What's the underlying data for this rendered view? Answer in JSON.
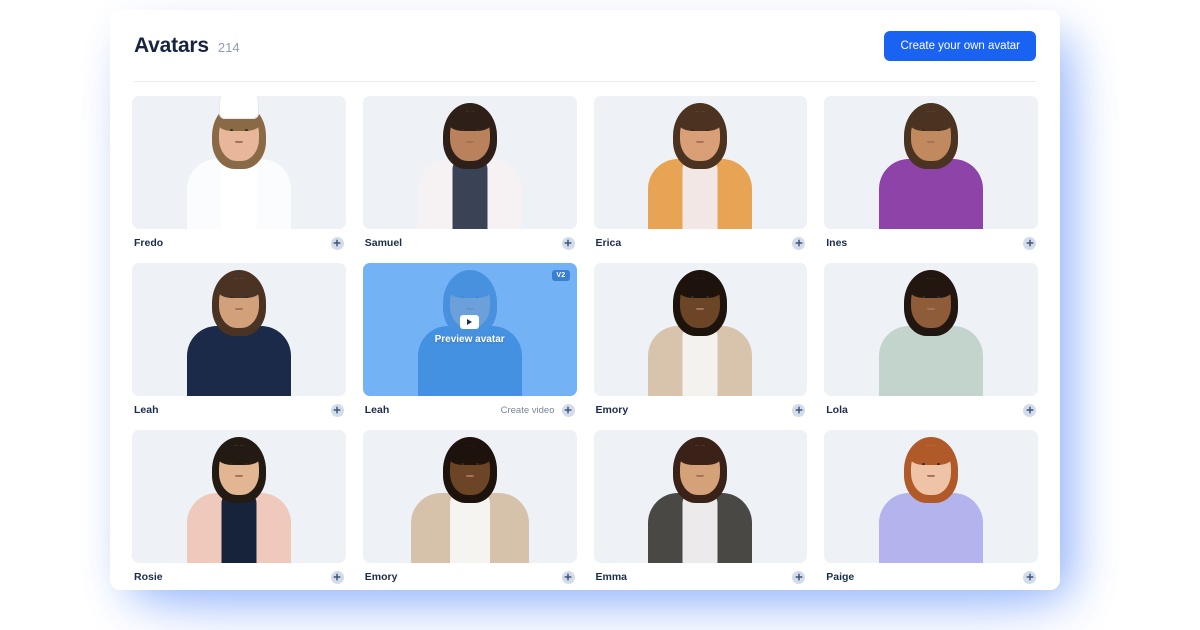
{
  "header": {
    "title": "Avatars",
    "count": "214",
    "create_button_label": "Create your own avatar"
  },
  "grid": {
    "avatars": [
      {
        "name": "Fredo",
        "description": "Male chef wearing a tall white chef's hat and white double-breasted chef jacket",
        "skin": "#e8b79a",
        "hair": "#8a6a46",
        "clothing": "#fbfcfd",
        "accent": "#ffffff",
        "state": "default"
      },
      {
        "name": "Samuel",
        "description": "Man with short curly dark hair and beard wearing a white lab coat over a dark navy shirt",
        "skin": "#b9825d",
        "hair": "#2e2018",
        "clothing": "#f6f2f4",
        "accent": "#3a4355",
        "state": "default"
      },
      {
        "name": "Erica",
        "description": "Woman with long curly brown hair wearing an orange cardigan over a white v-neck top",
        "skin": "#d9a078",
        "hair": "#4c3220",
        "clothing": "#e8a455",
        "accent": "#f2e7e4",
        "state": "default"
      },
      {
        "name": "Ines",
        "description": "Woman with a large afro wearing a purple sleeveless top",
        "skin": "#c08a5e",
        "hair": "#4a3320",
        "clothing": "#8d43a8",
        "accent": "#8d43a8",
        "state": "default"
      },
      {
        "name": "Leah",
        "description": "Woman with shoulder-length curly hair wearing a navy blue blazer",
        "skin": "#d2a17c",
        "hair": "#4b3323",
        "clothing": "#1c2a4a",
        "accent": "#1c2a4a",
        "state": "default"
      },
      {
        "name": "Leah",
        "description": "Woman with curly hair in a blue jacket, shown with blue preview overlay",
        "skin": "#d2a17c",
        "hair": "#2d5d92",
        "clothing": "#1f5e9c",
        "accent": "#1f5e9c",
        "state": "preview",
        "version_badge": "V2",
        "preview_label": "Preview avatar",
        "create_video_label": "Create video"
      },
      {
        "name": "Emory",
        "description": "Man with short hair and beard wearing a beige shirt over a white t-shirt",
        "skin": "#6b4526",
        "hair": "#1d130c",
        "clothing": "#d8c4ad",
        "accent": "#f4f2ef",
        "state": "default"
      },
      {
        "name": "Lola",
        "description": "Woman with short dark bob wearing a pale sage green blouse",
        "skin": "#8e5c38",
        "hair": "#221710",
        "clothing": "#c3d4cd",
        "accent": "#c3d4cd",
        "state": "default"
      },
      {
        "name": "Rosie",
        "description": "Woman with long straight dark hair wearing a blush pink blazer over a navy top",
        "skin": "#e2b693",
        "hair": "#231a14",
        "clothing": "#efc9bc",
        "accent": "#17223b",
        "state": "default"
      },
      {
        "name": "Emory",
        "description": "Man in a beige jacket over a white t-shirt, wider full-body framing",
        "skin": "#6b4526",
        "hair": "#1d130c",
        "clothing": "#d6c2ab",
        "accent": "#f6f4f1",
        "state": "default"
      },
      {
        "name": "Emma",
        "description": "Woman with hair tied back wearing a dark grey pinstripe suit over a white shirt",
        "skin": "#d5a179",
        "hair": "#3a2218",
        "clothing": "#4a4845",
        "accent": "#eceaea",
        "state": "default"
      },
      {
        "name": "Paige",
        "description": "Woman with long auburn red hair wearing a lavender blouse",
        "skin": "#eec3a6",
        "hair": "#b05a2a",
        "clothing": "#b3b3ee",
        "accent": "#b3b3ee",
        "state": "default"
      }
    ]
  },
  "colors": {
    "accent_blue": "#1a62f2",
    "thumb_bg": "#eef1f6",
    "title_color": "#16243e",
    "count_color": "#8f9cb3",
    "preview_overlay": "#50a0f5",
    "badge_bg": "#3b7fd4"
  }
}
